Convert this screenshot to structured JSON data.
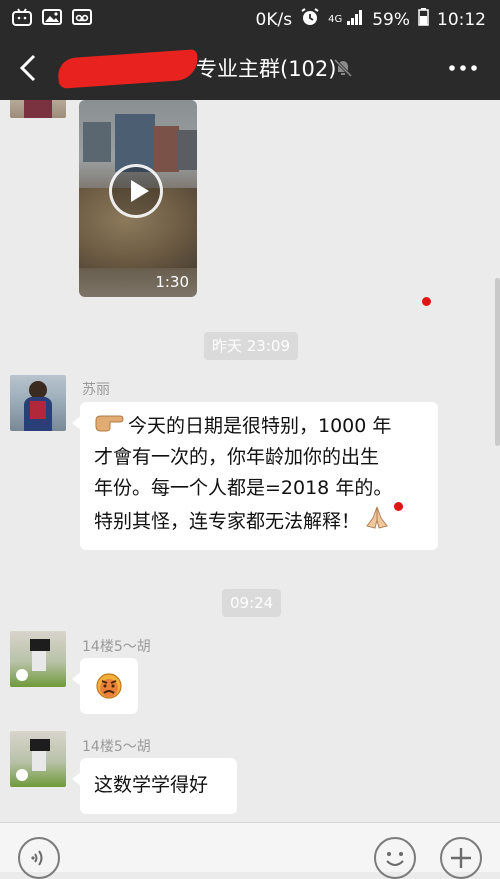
{
  "status_bar": {
    "network_speed": "0K/s",
    "network_type": "4G",
    "battery": "59%",
    "time": "10:12",
    "icons": [
      "bilibili-icon",
      "image-icon",
      "voicemail-icon",
      "alarm-icon",
      "signal-icon",
      "battery-icon"
    ]
  },
  "header": {
    "title": "专业主群(102)",
    "title_visible": "专业主群(102)",
    "back_icon": "back-arrow-icon",
    "mute_icon": "mute-bell-icon",
    "more_icon": "more-dots-icon"
  },
  "messages": {
    "video": {
      "duration": "1:30"
    },
    "time1": "昨天 23:09",
    "msg1": {
      "sender": "苏丽",
      "lines": [
        "今天的日期是很特别，1000 年",
        "才會有一次的，你年龄加你的出生",
        "年份。每一个人都是=2018 年的。",
        "特别其怪，连专家都无法解释！"
      ]
    },
    "time2": "09:24",
    "msg2": {
      "sender": "14楼5～胡"
    },
    "msg3": {
      "sender": "14楼5～胡",
      "text": "这数学学得好"
    }
  },
  "input_bar": {
    "voice_icon": "voice-icon",
    "emoji_icon": "emoji-icon",
    "plus_icon": "plus-icon"
  }
}
